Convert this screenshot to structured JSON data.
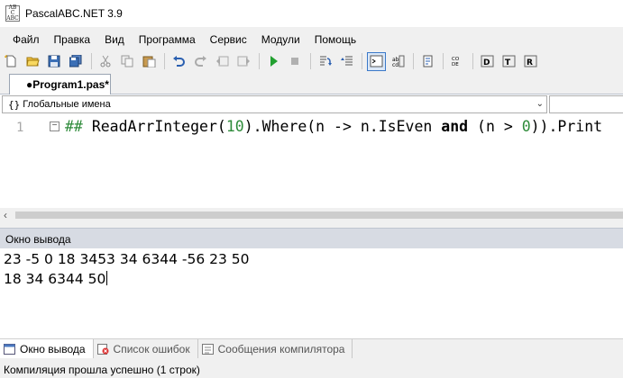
{
  "window": {
    "title": "PascalABC.NET 3.9",
    "icon_text": [
      "AB",
      "C",
      "ABC"
    ]
  },
  "menu": [
    "Файл",
    "Правка",
    "Вид",
    "Программа",
    "Сервис",
    "Модули",
    "Помощь"
  ],
  "toolbar": {
    "groups": [
      [
        "new-file-icon",
        "open-folder-icon",
        "save-icon",
        "save-all-icon"
      ],
      [
        "cut-icon",
        "copy-icon",
        "paste-icon"
      ],
      [
        "undo-icon",
        "redo-icon",
        "nav-back-icon",
        "nav-forward-icon"
      ],
      [
        "run-icon",
        "stop-icon"
      ],
      [
        "debug-step-icon",
        "debug-step-into-icon"
      ],
      [
        "console-icon",
        "auto-complete-icon"
      ],
      [
        "format-icon"
      ],
      [
        "code-template-icon"
      ],
      [
        "debug-run-icon",
        "debug-trace-icon",
        "debug-restart-icon"
      ]
    ],
    "active": "console-icon"
  },
  "editor_tab": {
    "label": "●Program1.pas*"
  },
  "scope_combo": {
    "icon": "{}",
    "value": "Глобальные имена"
  },
  "editor": {
    "line_number": "1",
    "fold": "−",
    "code": {
      "comment": "## ",
      "p1": "ReadArrInteger(",
      "num1": "10",
      "p2": ").",
      "where": "Where",
      "p3": "(n -> n.IsEven ",
      "and": "and",
      "p4": " (n > ",
      "num2": "0",
      "p5": ")).Print"
    }
  },
  "output_panel": {
    "title": "Окно вывода",
    "lines": [
      "23 -5 0 18 3453 34 6344 -56 23 50",
      "18 34 6344 50"
    ]
  },
  "bottom_tabs": [
    "Окно вывода",
    "Список ошибок",
    "Сообщения компилятора"
  ],
  "status": "Компиляция прошла успешно (1 строк)"
}
